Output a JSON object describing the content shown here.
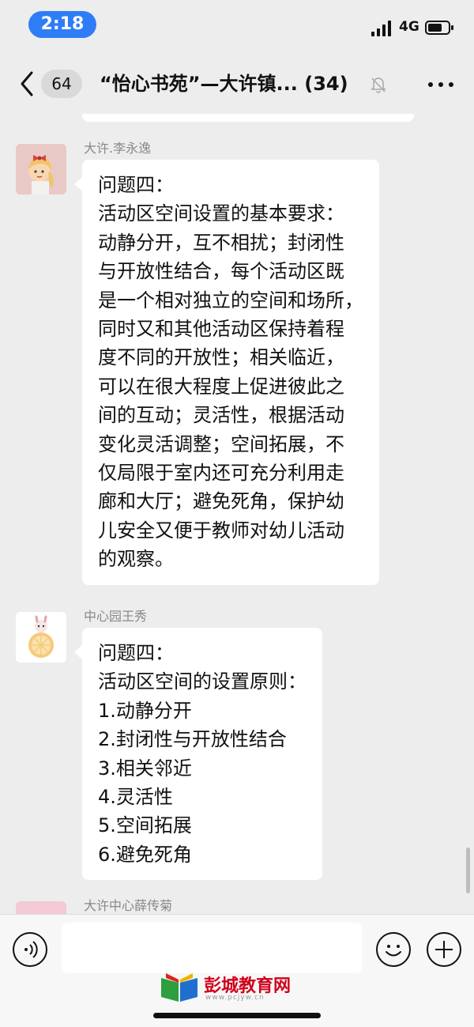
{
  "status_bar": {
    "time": "2:18",
    "network": "4G"
  },
  "nav": {
    "unread_count": "64",
    "title": "“怡心书苑”—大许镇...",
    "member_count": "(34)"
  },
  "messages": [
    {
      "sender": "大许.李永逸",
      "lines": [
        "问题四：",
        "活动区空间设置的基本要求：",
        "动静分开，互不相扰；封闭性",
        "与开放性结合，每个活动区既",
        "是一个相对独立的空间和场所，",
        "同时又和其他活动区保持着程",
        "度不同的开放性；相关临近，",
        "可以在很大程度上促进彼此之",
        "间的互动；灵活性，根据活动",
        "变化灵活调整；空间拓展，不",
        "仅局限于室内还可充分利用走",
        "廊和大厅；避免死角，保护幼",
        "儿安全又便于教师对幼儿活动",
        "的观察。"
      ]
    },
    {
      "sender": "中心园王秀",
      "lines": [
        "问题四：",
        "活动区空间的设置原则：",
        "1.动静分开",
        "2.封闭性与开放性结合",
        "3.相关邻近",
        "4.灵活性",
        "5.空间拓展",
        "6.避免死角"
      ]
    },
    {
      "sender": "大许中心薛传菊"
    }
  ],
  "watermark": {
    "text": "彭城教育网",
    "url": "www.pcjyw.cn"
  }
}
